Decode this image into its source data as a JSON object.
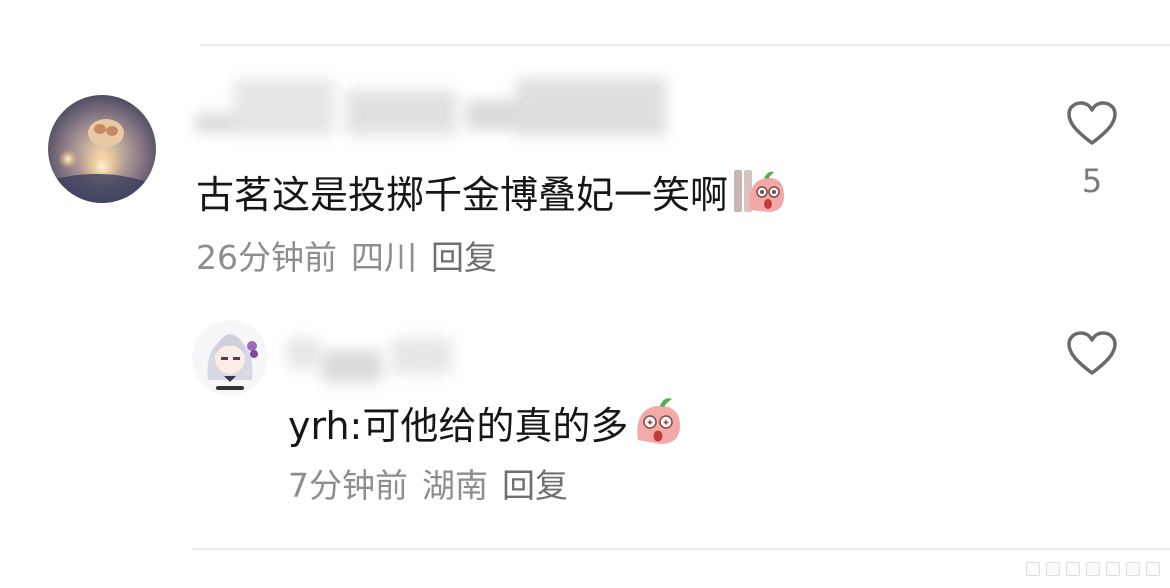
{
  "comments": [
    {
      "text": "古茗这是投掷千金博叠妃一笑啊",
      "time": "26分钟前",
      "location": "四川",
      "reply_label": "回复",
      "likes": "5",
      "emoji_icon": "peach-mascot-peek-icon"
    },
    {
      "text": "yrh:可他给的真的多",
      "time": "7分钟前",
      "location": "湖南",
      "reply_label": "回复",
      "emoji_icon": "peach-mascot-shocked-icon"
    }
  ],
  "colors": {
    "text": "#161616",
    "meta": "#8e8e8e",
    "divider": "#ececec",
    "heart": "#6a6a6a"
  }
}
